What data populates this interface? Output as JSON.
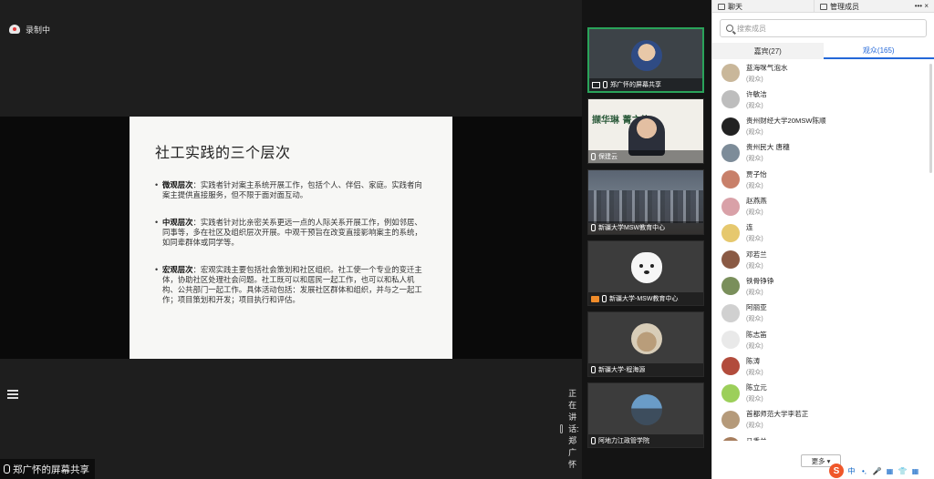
{
  "recording": {
    "label": "录制中"
  },
  "slide": {
    "title": "社工实践的三个层次",
    "bullets": [
      {
        "head": "微观层次",
        "text": "：实践者针对案主系统开展工作，包括个人、伴侣、家庭。实践者向案主提供直接服务，但不限于面对面互动。"
      },
      {
        "head": "中观层次",
        "text": "：实践者针对比亲密关系更远一点的人际关系开展工作，例如邻居、同事等，多在社区及组织层次开展。中观干预旨在改变直接影响案主的系统，如同辈群体或同学等。"
      },
      {
        "head": "宏观层次",
        "text": "：宏观实践主要包括社会策划和社区组织。社工使一个专业的变迁主体，协助社区处理社会问题。社工既可以和居民一起工作，也可以和私人机构、公共部门一起工作。具体活动包括：发展社区群体和组织，并与之一起工作；项目策划和开发；项目执行和评估。"
      }
    ]
  },
  "bottom_left": {
    "label": "郑广怀的屏幕共享"
  },
  "speaking": {
    "label": "正在讲话: 郑广怀"
  },
  "video_tiles": [
    {
      "label": "郑广怀的屏幕共享",
      "active": true
    },
    {
      "label": "保建云",
      "banner": "撷华琳  菁之旅"
    },
    {
      "label": "新疆大学MSW教育中心"
    },
    {
      "label": "新疆大学-MSW教育中心"
    },
    {
      "label": "新疆大学-程海源"
    },
    {
      "label": "阿地力江政管学院"
    }
  ],
  "panel": {
    "tabs": {
      "chat": "聊天",
      "members": "管理成员"
    },
    "window_controls": "••• ×",
    "search_placeholder": "搜索成员",
    "role_tabs": {
      "guests": "嘉宾(27)",
      "audience": "观众(165)"
    },
    "members": [
      {
        "name": "蓝海咪气泡水",
        "role": "(观众)",
        "color": "#c9b79a"
      },
      {
        "name": "许敏洁",
        "role": "(观众)",
        "color": "#bdbdbd"
      },
      {
        "name": "贵州财经大学20MSW陈顺",
        "role": "(观众)",
        "color": "#222222"
      },
      {
        "name": "贵州民大 唐穗",
        "role": "(观众)",
        "color": "#7d8c99"
      },
      {
        "name": "贾子怡",
        "role": "(观众)",
        "color": "#c8806a"
      },
      {
        "name": "赵燕燕",
        "role": "(观众)",
        "color": "#d9a1a8"
      },
      {
        "name": "连",
        "role": "(观众)",
        "color": "#e6c86e"
      },
      {
        "name": "邓若兰",
        "role": "(观众)",
        "color": "#8a5a44"
      },
      {
        "name": "铁骨铮铮",
        "role": "(观众)",
        "color": "#7a8f5b"
      },
      {
        "name": "阿丽亚",
        "role": "(观众)",
        "color": "#d0d0d0"
      },
      {
        "name": "陈志笛",
        "role": "(观众)",
        "color": "#e9e9e9"
      },
      {
        "name": "陈涛",
        "role": "(观众)",
        "color": "#b24c3c"
      },
      {
        "name": "陈立元",
        "role": "(观众)",
        "color": "#9ccf5a"
      },
      {
        "name": "首都师范大学李若芷",
        "role": "(观众)",
        "color": "#b59a7a"
      },
      {
        "name": "马秀兰",
        "role": "(观众)",
        "color": "#a77e5e"
      }
    ],
    "more_label": "更多 ▾",
    "ime": {
      "logo": "S",
      "items": [
        "中",
        "•,",
        "🎤",
        "▦",
        "👕",
        "▦"
      ]
    }
  }
}
